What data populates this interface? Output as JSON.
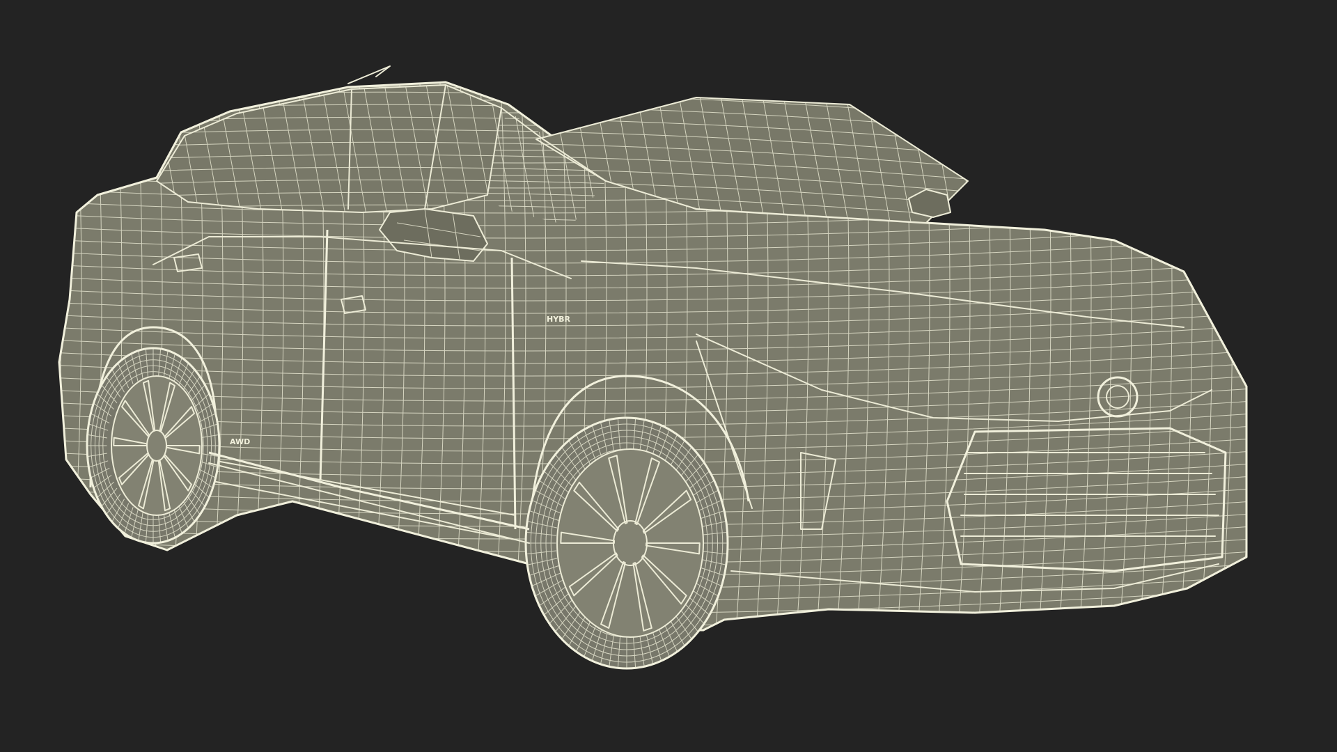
{
  "scene": {
    "subject": "wireframe-suv",
    "background_color": "#232323",
    "wire_color": "#ecebd6",
    "surface_color": "#7b7b6b"
  },
  "badges": {
    "side_badge": "HYBR",
    "door_badge": "AWD"
  }
}
